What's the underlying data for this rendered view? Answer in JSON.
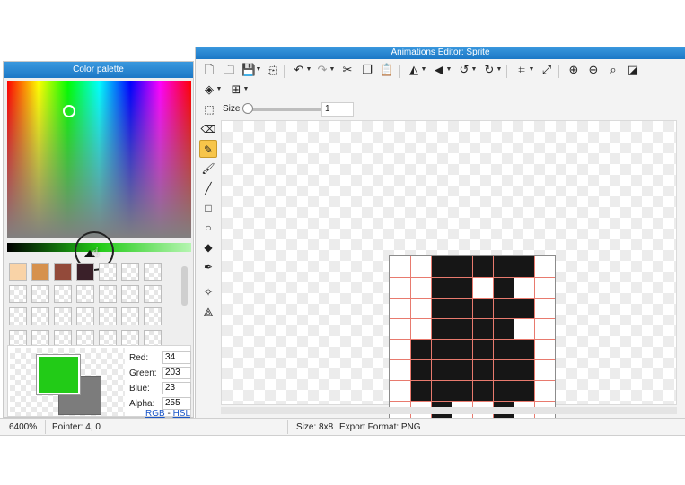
{
  "palette": {
    "title": "Color palette",
    "swatches": [
      {
        "color": "#f9d3a7"
      },
      {
        "color": "#d6914d"
      },
      {
        "color": "#934a3a"
      },
      {
        "color": "#3a2029"
      },
      {
        "color": ""
      },
      {
        "color": ""
      },
      {
        "color": ""
      },
      {
        "color": ""
      },
      {
        "color": ""
      },
      {
        "color": ""
      },
      {
        "color": ""
      },
      {
        "color": ""
      },
      {
        "color": ""
      },
      {
        "color": ""
      },
      {
        "color": ""
      },
      {
        "color": ""
      },
      {
        "color": ""
      },
      {
        "color": ""
      },
      {
        "color": ""
      },
      {
        "color": ""
      },
      {
        "color": ""
      },
      {
        "color": ""
      },
      {
        "color": ""
      },
      {
        "color": ""
      },
      {
        "color": ""
      },
      {
        "color": ""
      },
      {
        "color": ""
      },
      {
        "color": ""
      }
    ],
    "primary_color": "#22cb17",
    "secondary_color": "#7c7c7c",
    "channels": {
      "red_label": "Red:",
      "red": "34",
      "green_label": "Green:",
      "green": "203",
      "blue_label": "Blue:",
      "blue": "23",
      "alpha_label": "Alpha:",
      "alpha": "255"
    },
    "mode_rgb": "RGB",
    "mode_sep": " - ",
    "mode_hsl": "HSL"
  },
  "editor": {
    "title": "Animations Editor: Sprite",
    "size_label": "Size",
    "size_value": "1",
    "toolbar_icons": [
      "new-file-icon",
      "open-folder-icon",
      "save-icon",
      "import-icon",
      "undo-icon",
      "redo-icon",
      "cut-icon",
      "copy-icon",
      "paste-icon",
      "flip-horizontal-icon",
      "flip-vertical-icon",
      "rotate-left-icon",
      "rotate-right-icon",
      "crop-icon",
      "resize-icon",
      "zoom-in-icon",
      "zoom-out-icon",
      "zoom-fit-icon",
      "invert-icon",
      "layers-icon",
      "grid-icon"
    ],
    "side_tools": [
      "selection-icon",
      "eraser-icon",
      "pencil-icon",
      "brush-icon",
      "line-icon",
      "rectangle-icon",
      "ellipse-icon",
      "fill-bucket-icon",
      "eyedropper-icon",
      "move-icon",
      "transform-icon"
    ],
    "active_tool": "pencil-icon",
    "sprite": {
      "width": 8,
      "height": 8,
      "fill_color": "#161616",
      "grid_color": "#e87a6e",
      "pixels": [
        "00111110",
        "00110100",
        "00111110",
        "00111100",
        "01111110",
        "01111110",
        "01111110",
        "00100100"
      ]
    }
  },
  "status": {
    "zoom": "6400%",
    "pointer": "Pointer: 4, 0",
    "size": "Size: 8x8",
    "export_format": "Export Format: PNG"
  }
}
